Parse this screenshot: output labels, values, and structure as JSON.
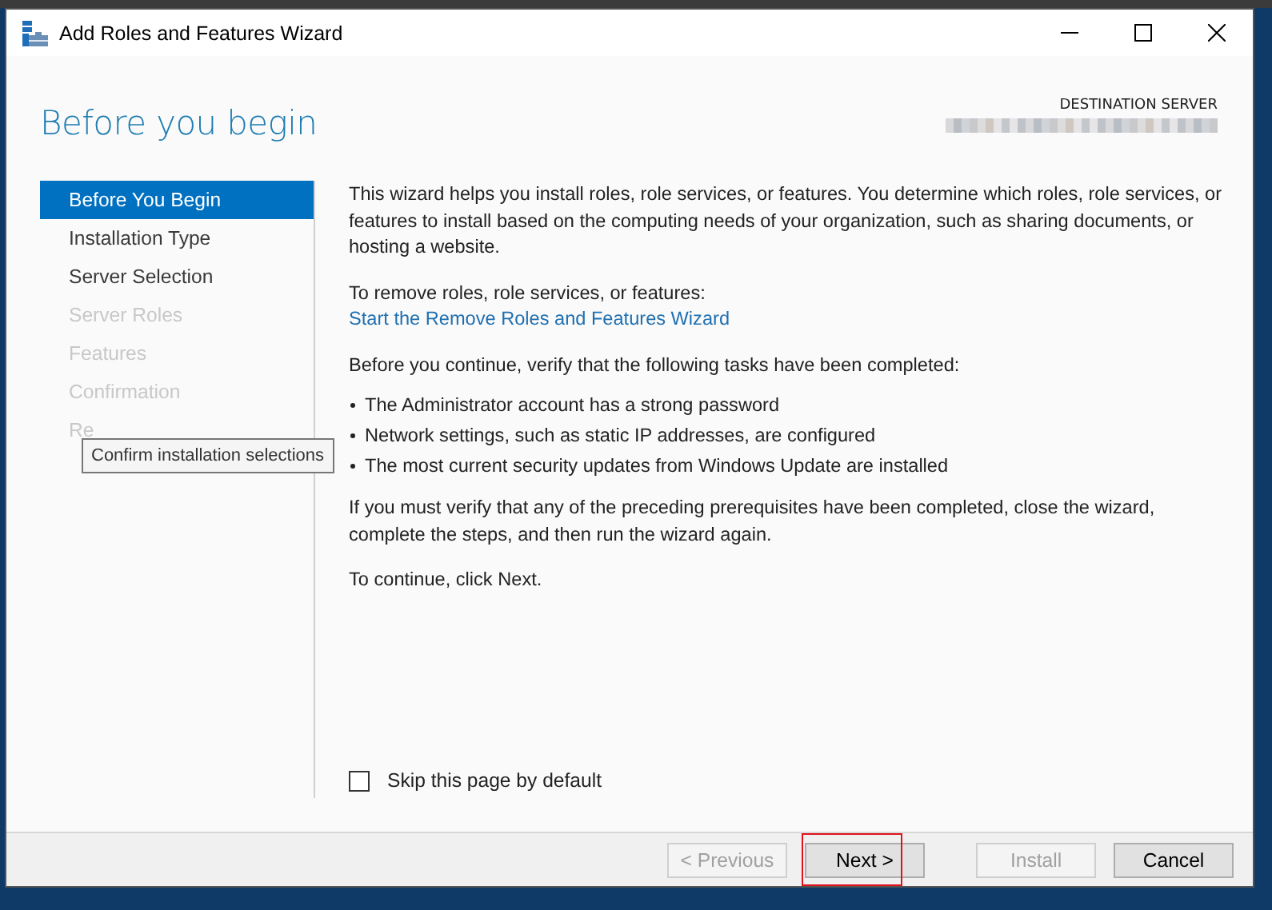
{
  "window": {
    "title": "Add Roles and Features Wizard"
  },
  "header": {
    "title": "Before you begin",
    "destination_label": "DESTINATION SERVER"
  },
  "steps": [
    {
      "label": "Before You Begin",
      "selected": true,
      "disabled": false
    },
    {
      "label": "Installation Type",
      "selected": false,
      "disabled": false
    },
    {
      "label": "Server Selection",
      "selected": false,
      "disabled": false
    },
    {
      "label": "Server Roles",
      "selected": false,
      "disabled": true
    },
    {
      "label": "Features",
      "selected": false,
      "disabled": true
    },
    {
      "label": "Confirmation",
      "selected": false,
      "disabled": true
    },
    {
      "label": "Re",
      "selected": false,
      "disabled": true
    }
  ],
  "tooltip": {
    "text": "Confirm installation selections"
  },
  "content": [
    {
      "kind": "paragraph",
      "text": "This wizard helps you install roles, role services, or features. You determine which roles, role services, or features to install based on the computing needs of your organization, such as sharing documents, or hosting a website."
    },
    {
      "kind": "paragraph_link",
      "text": "To remove roles, role services, or features:",
      "link": "Start the Remove Roles and Features Wizard"
    },
    {
      "kind": "paragraph",
      "text": "Before you continue, verify that the following tasks have been completed:"
    },
    {
      "kind": "bullets",
      "items": [
        "The Administrator account has a strong password",
        "Network settings, such as static IP addresses, are configured",
        "The most current security updates from Windows Update are installed"
      ]
    },
    {
      "kind": "paragraph",
      "text": "If you must verify that any of the preceding prerequisites have been completed, close the wizard, complete the steps, and then run the wizard again."
    },
    {
      "kind": "paragraph",
      "text": "To continue, click Next."
    }
  ],
  "skip_checkbox": {
    "label": "Skip this page by default",
    "checked": false
  },
  "buttons": [
    {
      "label": "< Previous",
      "disabled": true,
      "highlighted": false
    },
    {
      "label": "Next >",
      "disabled": false,
      "highlighted": true
    },
    {
      "label": "Install",
      "disabled": true,
      "highlighted": false
    },
    {
      "label": "Cancel",
      "disabled": false,
      "highlighted": false
    }
  ]
}
